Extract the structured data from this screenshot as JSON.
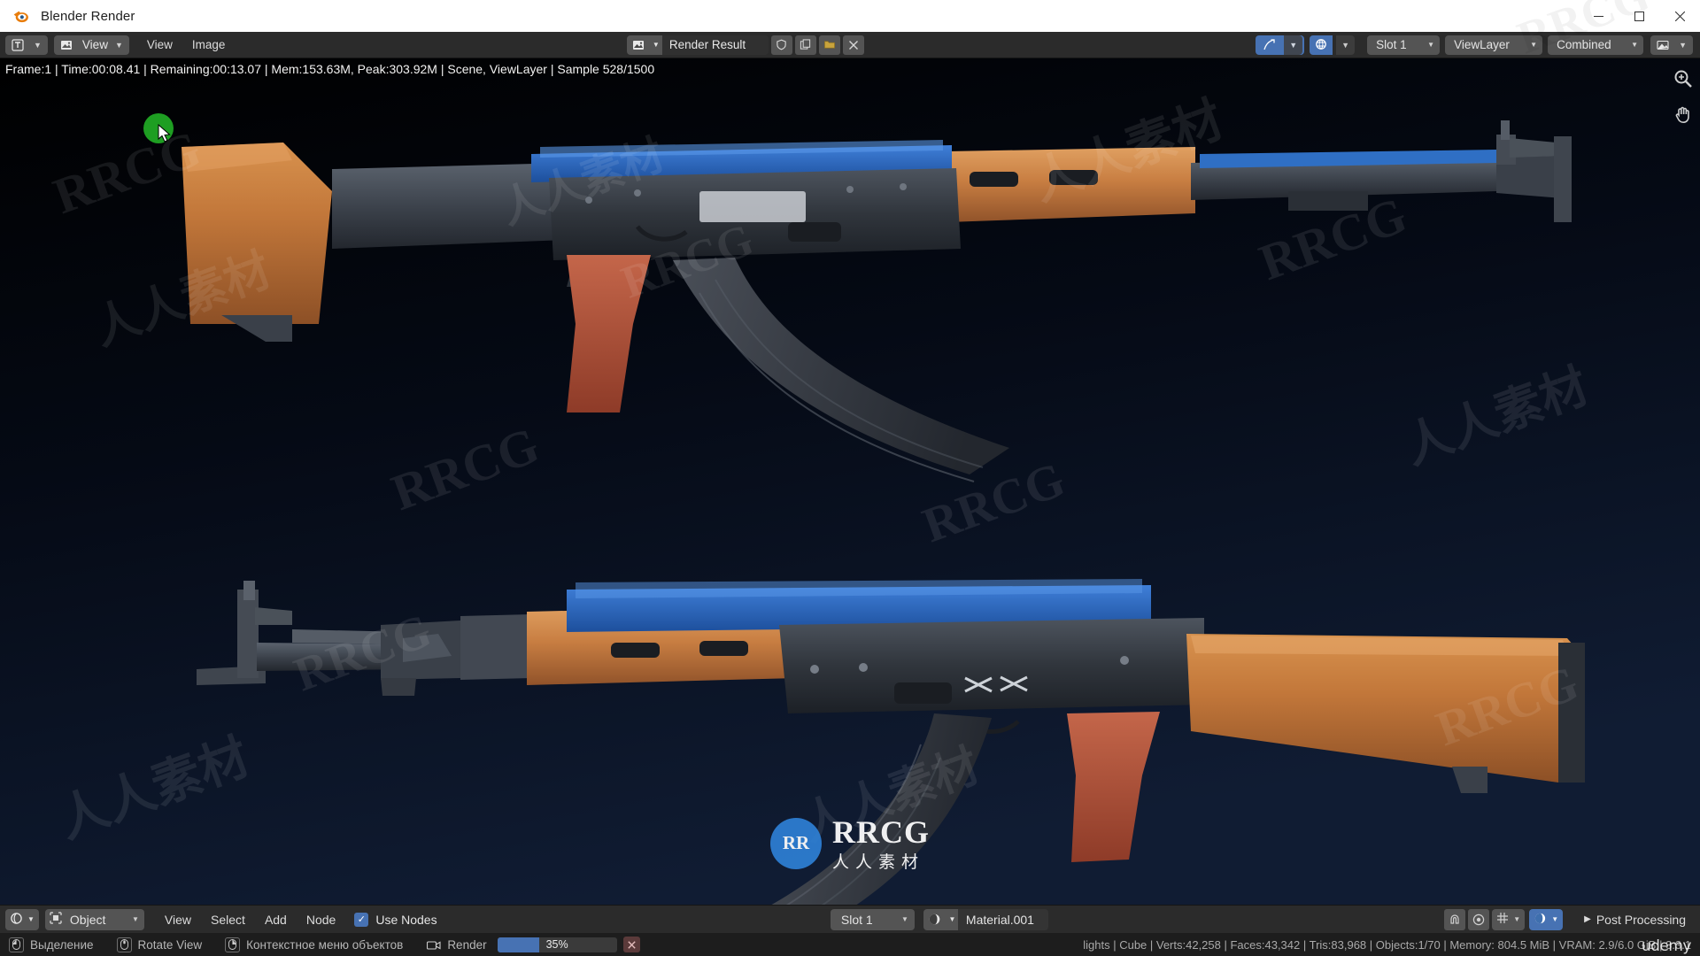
{
  "window": {
    "title": "Blender Render",
    "logo_icon": "blender-logo-icon",
    "minimize_label": "—",
    "maximize_label": "▢",
    "close_label": "✕"
  },
  "image_editor_header": {
    "editor_type_icon": "image-editor-type-icon",
    "editor_type_chevron": "chevron-down-icon",
    "view_mode_icon": "image-view-mode-icon",
    "view_mode_label": "View",
    "view_mode_chevron": "chevron-down-icon",
    "menus": [
      "View",
      "Image"
    ],
    "datablock": {
      "icon": "image-datablock-icon",
      "chevron": "chevron-down-icon",
      "name": "Render Result",
      "shield_icon": "fake-user-shield-icon",
      "copy_icon": "new-image-copy-icon",
      "open_icon": "open-image-folder-icon",
      "close_icon": "unlink-x-icon"
    },
    "right_controls": {
      "gizmo_icon": "gizmo-toggle-icon",
      "gizmo_chevron": "chevron-down-icon",
      "overlays_icon": "overlays-toggle-icon",
      "overlays_chevron": "chevron-down-icon",
      "slot_label": "Slot 1",
      "slot_chevron": "chevron-down-icon",
      "viewlayer_label": "ViewLayer",
      "viewlayer_chevron": "chevron-down-icon",
      "pass_label": "Combined",
      "pass_chevron": "chevron-down-icon",
      "display_icon": "display-channels-icon",
      "display_chevron": "chevron-down-icon"
    }
  },
  "viewport": {
    "render_info": "Frame:1 | Time:00:08.41 | Remaining:00:13.07 | Mem:153.63M, Peak:303.92M | Scene, ViewLayer | Sample 528/1500",
    "side_tools": [
      "zoom-magnifier-icon",
      "pan-hand-icon"
    ],
    "cursor_icon": "mouse-cursor-icon",
    "cursor_highlight_color": "#1e9e22",
    "watermark_text": "RRCG",
    "watermark_cn": "人人素材",
    "center_logo": {
      "circle_text": "RR",
      "line1": "RRCG",
      "line2": "人人素材"
    }
  },
  "node_editor_header": {
    "editor_type_icon": "shader-editor-type-icon",
    "editor_type_chevron": "chevron-down-icon",
    "shader_type_icon": "object-shader-icon",
    "shader_type_label": "Object",
    "shader_type_chevron": "chevron-down-icon",
    "menus": [
      "View",
      "Select",
      "Add",
      "Node"
    ],
    "use_nodes_checked": true,
    "use_nodes_label": "Use Nodes",
    "slot_label": "Slot 1",
    "slot_chevron": "chevron-down-icon",
    "material": {
      "icon": "material-sphere-icon",
      "chevron": "chevron-down-icon",
      "name": "Material.001"
    },
    "right_icons": [
      "snap-magnet-icon",
      "proportional-edit-icon",
      "snap-grid-icon",
      "snap-grid-chevron-icon",
      "shading-sphere-icon",
      "shading-chevron-icon"
    ],
    "post_processing_chevron": "chevron-right-icon",
    "post_processing_label": "Post Processing"
  },
  "status_bar": {
    "items": [
      {
        "key": "mouse-left-icon",
        "label": "Выделение"
      },
      {
        "key": "mouse-middle-icon",
        "label": "Rotate View"
      },
      {
        "key": "mouse-right-icon",
        "label": "Контекстное меню объектов"
      }
    ],
    "render": {
      "icon": "render-camera-icon",
      "label": "Render",
      "progress_percent": 35,
      "progress_text": "35%",
      "cancel_icon": "cancel-x-icon"
    },
    "scene_stats": "lights | Cube | Verts:42,258 | Faces:43,342 | Tris:83,968 | Objects:1/70 | Memory: 804.5 MiB | VRAM: 2.9/6.0 GiB | 3.3.1",
    "branding": "udemy"
  },
  "colors": {
    "accent_blue": "#4772b3",
    "header_gray": "#2b2b2b",
    "widget_gray": "#545454",
    "status_bg": "#1d1d1d",
    "render_bg_dark": "#0a1020",
    "gun_wood": "#c4763a",
    "gun_blue": "#2b62b0",
    "gun_metal": "#3a3f47",
    "grip_red": "#b5523a"
  }
}
